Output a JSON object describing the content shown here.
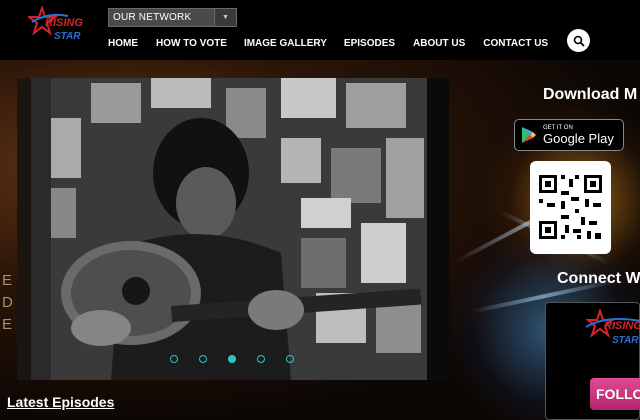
{
  "brand": {
    "logo_line1": "RISING",
    "logo_line2": "STAR",
    "accent_red": "#d8232a",
    "accent_blue": "#2a6fd8"
  },
  "header": {
    "network_select": {
      "selected": "OUR NETWORK"
    },
    "nav": [
      {
        "label": "HOME"
      },
      {
        "label": "HOW TO VOTE"
      },
      {
        "label": "IMAGE GALLERY"
      },
      {
        "label": "EPISODES"
      },
      {
        "label": "ABOUT US"
      },
      {
        "label": "CONTACT US"
      }
    ],
    "search_icon": "search-icon"
  },
  "slider": {
    "dot_count": 5,
    "active_dot": 3,
    "dot_color": "#2ec4c4",
    "edge_text": "E\nD\nE"
  },
  "right_panel": {
    "download_title": "Download M",
    "google_play": {
      "small": "GET IT ON",
      "big": "Google Play"
    },
    "connect_title": "Connect W",
    "follow_label": "FOLLOW",
    "card_logo_line1": "RISING",
    "card_logo_line2": "STAR"
  },
  "sections": {
    "latest_episodes": "Latest Episodes"
  }
}
